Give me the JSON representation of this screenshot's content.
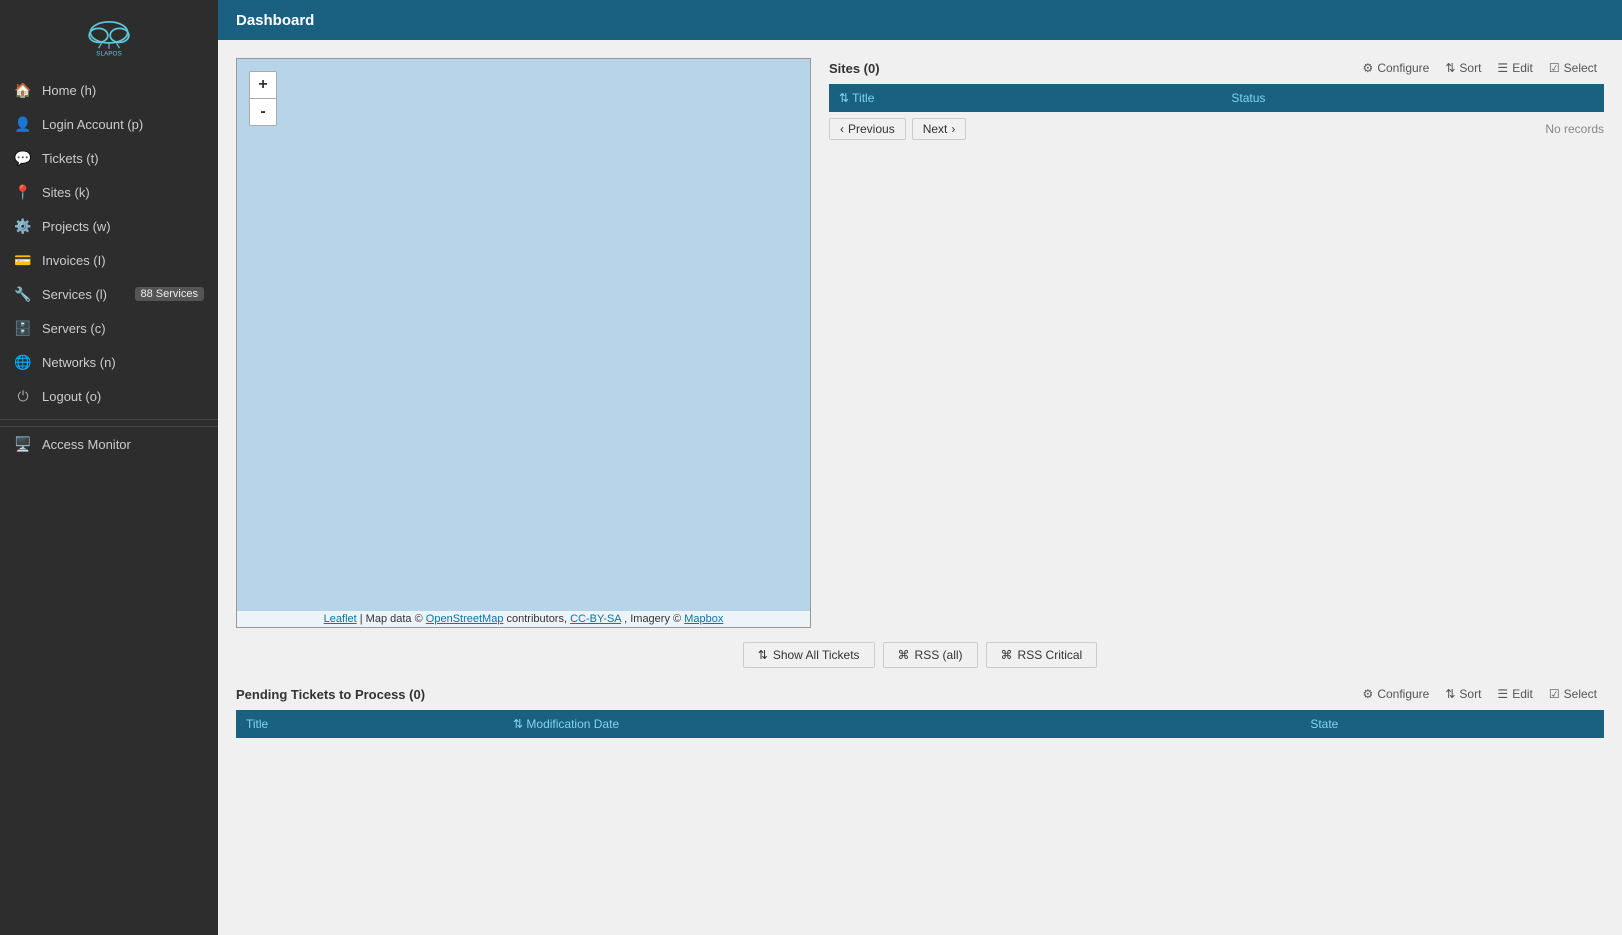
{
  "sidebar": {
    "logo_alt": "SlapOS logo",
    "items": [
      {
        "id": "home",
        "label": "Home (h)",
        "icon": "🏠"
      },
      {
        "id": "login-account",
        "label": "Login Account (p)",
        "icon": "👤"
      },
      {
        "id": "tickets",
        "label": "Tickets (t)",
        "icon": "💬"
      },
      {
        "id": "sites",
        "label": "Sites (k)",
        "icon": "📍"
      },
      {
        "id": "projects",
        "label": "Projects (w)",
        "icon": "⚙️"
      },
      {
        "id": "invoices",
        "label": "Invoices (I)",
        "icon": "💳"
      },
      {
        "id": "services",
        "label": "Services (l)",
        "icon": "🔧",
        "badge": "88 Services"
      },
      {
        "id": "servers",
        "label": "Servers (c)",
        "icon": "🗄️"
      },
      {
        "id": "networks",
        "label": "Networks (n)",
        "icon": "🌐"
      },
      {
        "id": "logout",
        "label": "Logout (o)",
        "icon": "⏻"
      }
    ],
    "access_monitor": {
      "label": "Access Monitor",
      "icon": "🖥️"
    }
  },
  "topbar": {
    "title": "Dashboard"
  },
  "sites_panel": {
    "title": "Sites (0)",
    "toolbar": {
      "configure_label": "Configure",
      "sort_label": "Sort",
      "edit_label": "Edit",
      "select_label": "Select"
    },
    "table": {
      "columns": [
        "Title",
        "Status"
      ],
      "rows": [],
      "no_records": "No records"
    },
    "pagination": {
      "previous": "Previous",
      "next": "Next"
    }
  },
  "map": {
    "zoom_in": "+",
    "zoom_out": "-",
    "attribution": "Leaflet | Map data ©OpenStreetMap contributors, CC-BY-SA, Imagery © Mapbox"
  },
  "ticket_actions": {
    "show_all": "Show All Tickets",
    "rss_all": "RSS (all)",
    "rss_critical": "RSS Critical"
  },
  "pending_section": {
    "title": "Pending Tickets to Process (0)",
    "toolbar": {
      "configure_label": "Configure",
      "sort_label": "Sort",
      "edit_label": "Edit",
      "select_label": "Select"
    },
    "table": {
      "columns": [
        "Title",
        "Modification Date",
        "State"
      ],
      "rows": []
    }
  }
}
